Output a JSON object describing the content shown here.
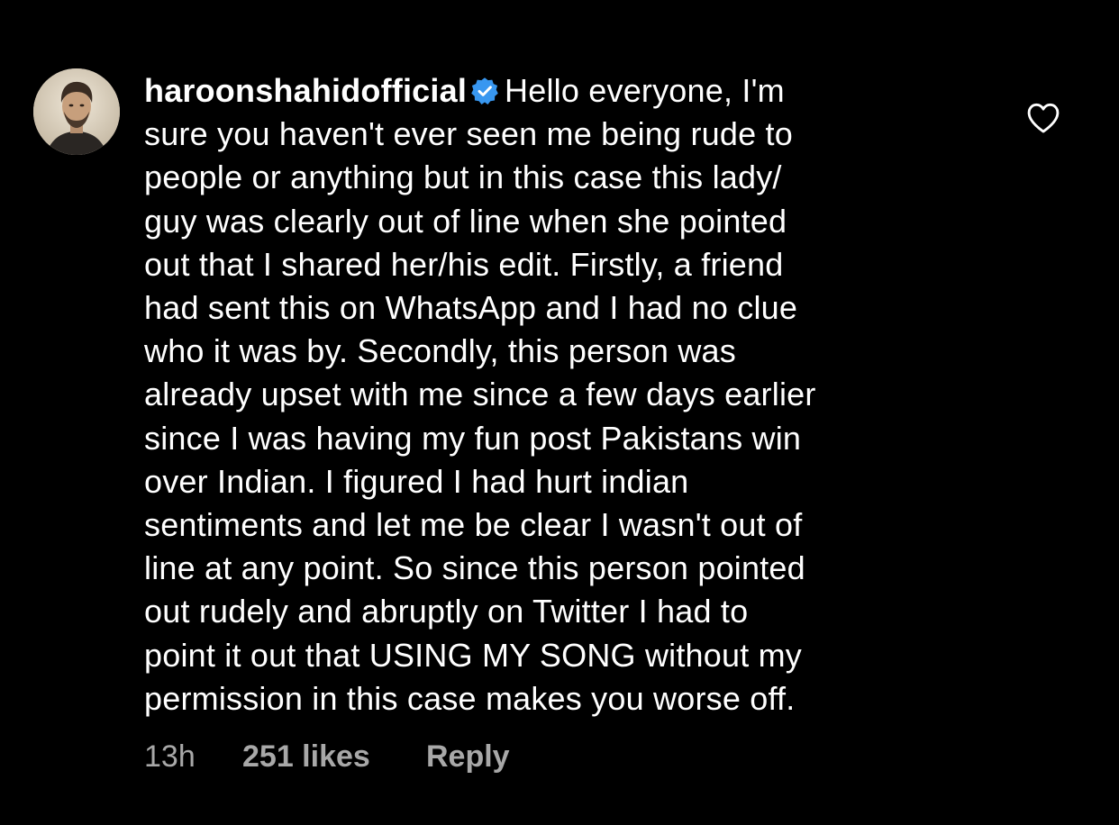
{
  "comment": {
    "username": "haroonshahidofficial",
    "verified_icon": "verified-badge-icon",
    "avatar_icon": "profile-avatar",
    "lines": [
      "Hello everyone, I'm",
      "sure you haven't ever seen me being rude to",
      "people or anything but in this case this lady/",
      "guy was clearly out of line when she pointed",
      "out that I shared her/his edit. Firstly, a friend",
      "had sent this on WhatsApp and I had no clue",
      "who it was by. Secondly, this person was",
      "already upset with me since a few days earlier",
      "since I was having my fun post Pakistans win",
      "over Indian. I figured I had hurt indian",
      "sentiments and let me be clear I wasn't out of",
      "line at any point. So since this person pointed",
      "out rudely and abruptly on Twitter I had to",
      "point it out that USING MY SONG without my",
      "permission in this case makes you worse off."
    ],
    "like_icon": "heart-outline-icon"
  },
  "footer": {
    "time": "13h",
    "likes": "251 likes",
    "reply": "Reply"
  },
  "colors": {
    "background": "#000000",
    "text": "#ffffff",
    "meta": "#a8a8a8",
    "verified": "#3897f0"
  }
}
